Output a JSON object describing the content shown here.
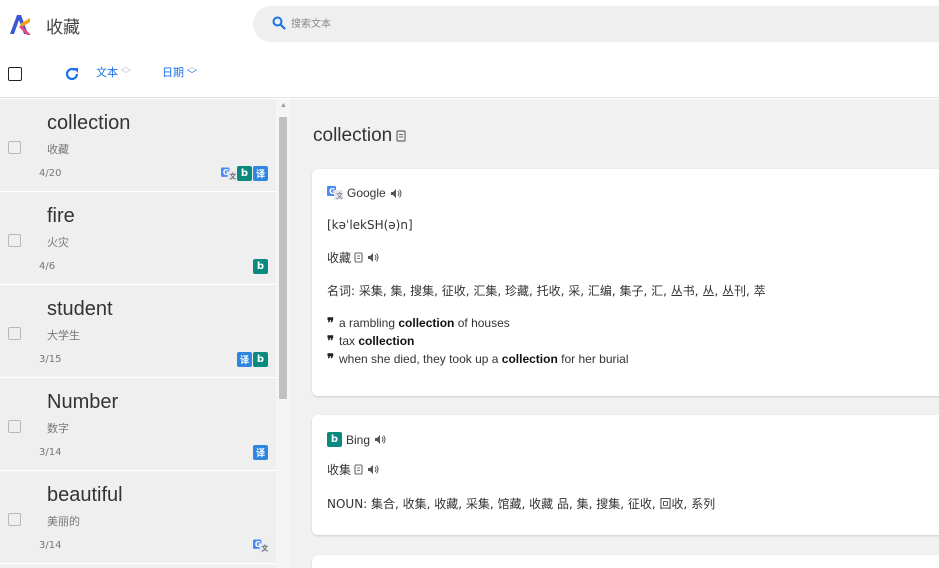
{
  "header": {
    "title": "收藏",
    "search_placeholder": "搜索文本"
  },
  "toolbar": {
    "sort_text_label": "文本",
    "sort_date_label": "日期"
  },
  "colors": {
    "bing": "#0a8a7e",
    "youdao": "#2e86de",
    "accent": "#1a73e8"
  },
  "list": [
    {
      "word": "collection",
      "translation": "收藏",
      "count": "4/20",
      "sources": [
        "google",
        "bing",
        "youdao"
      ]
    },
    {
      "word": "fire",
      "translation": "火灾",
      "count": "4/6",
      "sources": [
        "bing"
      ]
    },
    {
      "word": "student",
      "translation": "大学生",
      "count": "3/15",
      "sources": [
        "youdao",
        "bing"
      ]
    },
    {
      "word": "Number",
      "translation": "数字",
      "count": "3/14",
      "sources": [
        "youdao"
      ]
    },
    {
      "word": "beautiful",
      "translation": "美丽的",
      "count": "3/14",
      "sources": [
        "google"
      ]
    }
  ],
  "badge_labels": {
    "youdao": "译",
    "bing": "b"
  },
  "detail": {
    "word": "collection",
    "google": {
      "name": "Google",
      "phonetic": "[kəˈlekSH(ə)n]",
      "translation": "收藏",
      "definitions": "名词: 采集, 集, 搜集, 征收, 汇集, 珍藏, 托收, 采, 汇编, 集子, 汇, 丛书, 丛, 丛刊, 萃",
      "examples": [
        {
          "before": "a rambling ",
          "bold": "collection",
          "after": " of houses"
        },
        {
          "before": "tax ",
          "bold": "collection",
          "after": ""
        },
        {
          "before": "when she died, they took up a ",
          "bold": "collection",
          "after": " for her burial"
        }
      ]
    },
    "bing": {
      "name": "Bing",
      "translation": "收集",
      "definitions": "NOUN: 集合, 收集, 收藏, 采集, 馆藏, 收藏 品, 集, 搜集, 征收, 回收, 系列"
    }
  }
}
